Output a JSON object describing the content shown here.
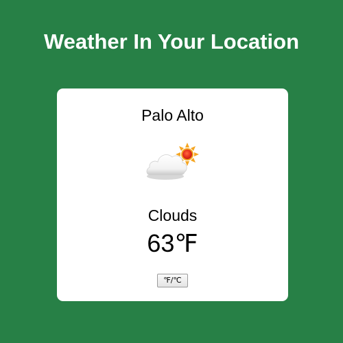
{
  "header": {
    "title": "Weather In Your Location"
  },
  "weather": {
    "city": "Palo Alto",
    "icon": "cloud-sun-icon",
    "condition": "Clouds",
    "temperature": "63℉"
  },
  "controls": {
    "unit_toggle_label": "℉/℃"
  },
  "colors": {
    "background": "#278046",
    "card": "#ffffff",
    "title_text": "#ffffff",
    "sun": "#f5a623",
    "sun_core": "#e8321e"
  }
}
